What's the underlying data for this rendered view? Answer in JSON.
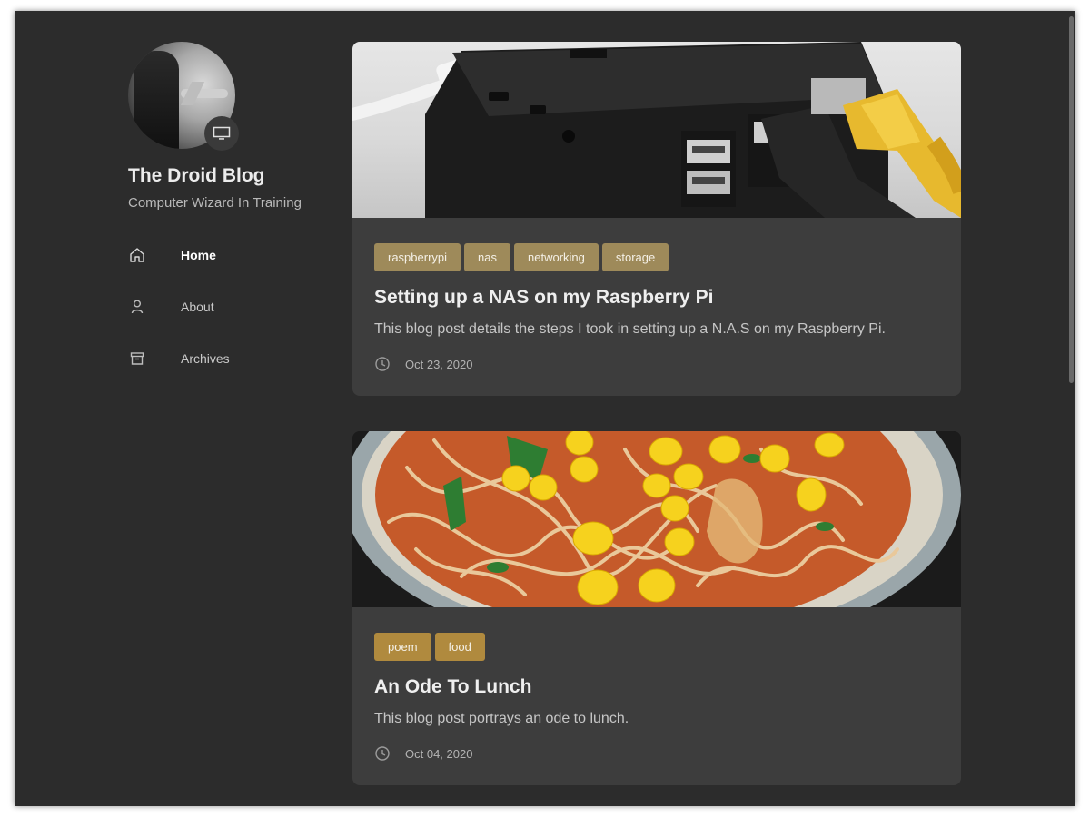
{
  "site": {
    "title": "The Droid Blog",
    "subtitle": "Computer Wizard In Training"
  },
  "nav": {
    "items": [
      {
        "label": "Home",
        "icon": "home-icon",
        "active": true
      },
      {
        "label": "About",
        "icon": "person-icon",
        "active": false
      },
      {
        "label": "Archives",
        "icon": "archive-icon",
        "active": false
      }
    ]
  },
  "posts": [
    {
      "image": "raspberry-pi-case-with-cables",
      "tags": [
        "raspberrypi",
        "nas",
        "networking",
        "storage"
      ],
      "title": "Setting up a NAS on my Raspberry Pi",
      "excerpt": "This blog post details the steps I took in setting up a N.A.S on my Raspberry Pi.",
      "date": "Oct 23, 2020"
    },
    {
      "image": "bowl-of-noodles-with-corn",
      "tags": [
        "poem",
        "food"
      ],
      "title": "An Ode To Lunch",
      "excerpt": "This blog post portrays an ode to lunch.",
      "date": "Oct 04, 2020"
    }
  ],
  "colors": {
    "background": "#2c2c2c",
    "card": "#3d3d3d",
    "tag": "#9e8a5a",
    "tag_food": "#b08a3e"
  }
}
